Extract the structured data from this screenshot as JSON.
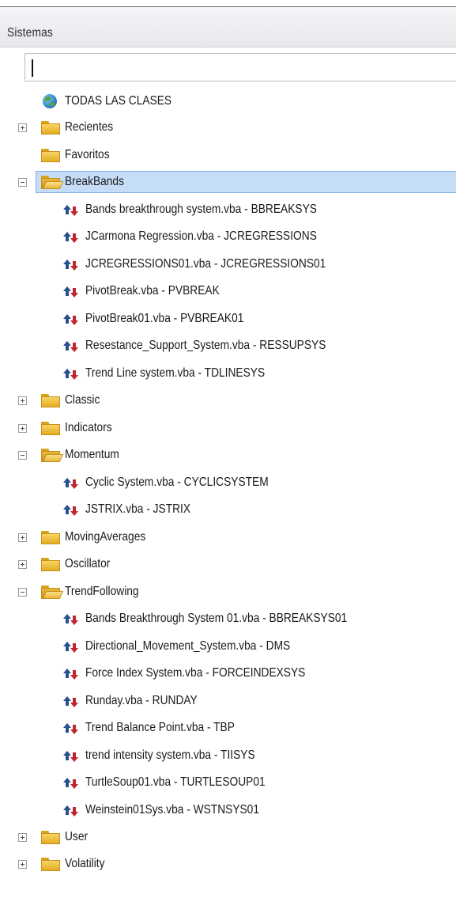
{
  "header": {
    "title": "Sistemas"
  },
  "search": {
    "value": "",
    "placeholder": ""
  },
  "tree": {
    "all_classes": "TODAS LAS CLASES",
    "recientes": "Recientes",
    "favoritos": "Favoritos",
    "breakbands": {
      "label": "BreakBands",
      "items": [
        "Bands breakthrough system.vba - BBREAKSYS",
        "JCarmona Regression.vba - JCREGRESSIONS",
        "JCREGRESSIONS01.vba - JCREGRESSIONS01",
        "PivotBreak.vba - PVBREAK",
        "PivotBreak01.vba - PVBREAK01",
        "Resestance_Support_System.vba - RESSUPSYS",
        "Trend Line system.vba - TDLINESYS"
      ]
    },
    "classic": "Classic",
    "indicators": "Indicators",
    "momentum": {
      "label": "Momentum",
      "items": [
        "Cyclic System.vba - CYCLICSYSTEM",
        "JSTRIX.vba - JSTRIX"
      ]
    },
    "movingaverages": "MovingAverages",
    "oscillator": "Oscillator",
    "trendfollowing": {
      "label": "TrendFollowing",
      "items": [
        "Bands Breakthrough System 01.vba - BBREAKSYS01",
        "Directional_Movement_System.vba - DMS",
        "Force Index System.vba - FORCEINDEXSYS",
        "Runday.vba - RUNDAY",
        "Trend Balance Point.vba - TBP",
        "trend intensity system.vba - TIISYS",
        "TurtleSoup01.vba - TURTLESOUP01",
        "Weinstein01Sys.vba - WSTNSYS01"
      ]
    },
    "user": "User",
    "volatility": "Volatility"
  }
}
